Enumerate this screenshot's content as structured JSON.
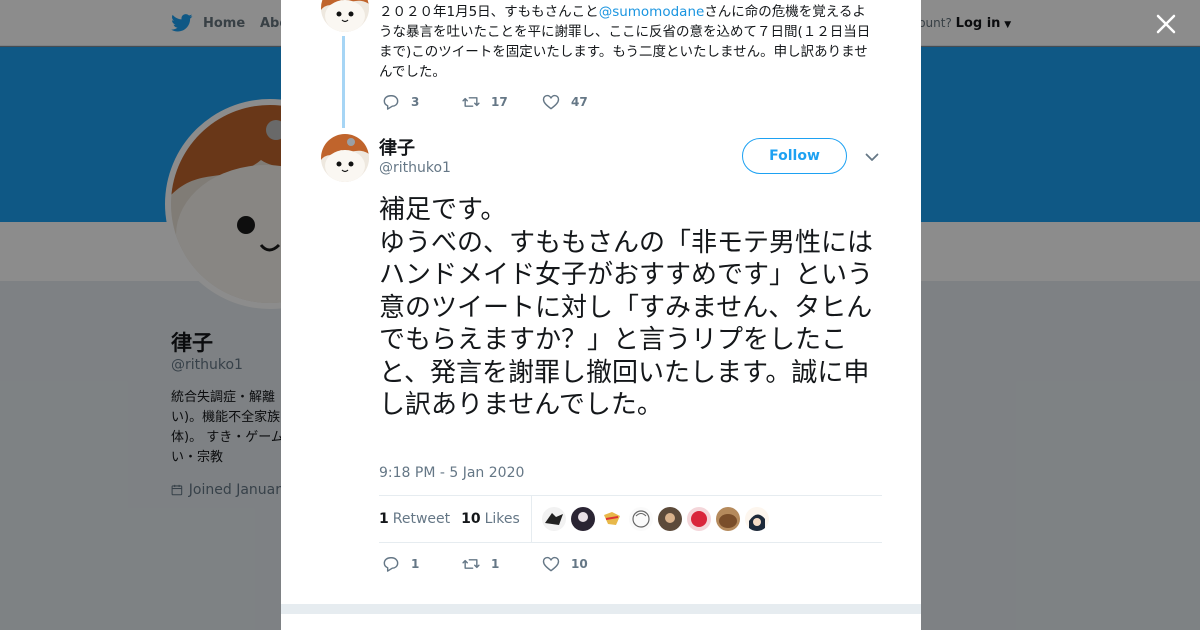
{
  "background": {
    "nav_home": "Home",
    "nav_about": "Abo",
    "account_prompt": "ccount?",
    "login_label": "Log in",
    "profile_name": "律子",
    "profile_handle": "@rithuko1",
    "bio": "統合失調症・解離 い)。機能不全家族 体)。 すき・ゲーム い・宗教",
    "joined": "Joined Januar",
    "banner_color": "#1da1f2"
  },
  "parent_tweet": {
    "text_before": "２０２０年1月5日、すももさんこと",
    "mention": "@sumomodane",
    "text_after": "さんに命の危機を覚えるような暴言を吐いたことを平に謝罪し、ここに反省の意を込めて７日間(１２日当日まで)このツイートを固定いたします。もう二度といたしません。申し訳ありませんでした。",
    "replies": "3",
    "retweets": "17",
    "likes": "47"
  },
  "tweet": {
    "author_name": "律子",
    "author_handle": "@rithuko1",
    "follow_label": "Follow",
    "body": "補足です。\nゆうべの、すももさんの「非モテ男性にはハンドメイド女子がおすすめです」という意のツイートに対し「すみません、タヒんでもらえますか？」と言うリプをしたこと、発言を謝罪し撤回いたします。誠に申し訳ありませんでした。",
    "timestamp": "9:18 PM - 5 Jan 2020",
    "retweet_count": "1",
    "retweet_label": "Retweet",
    "like_count": "10",
    "like_label": "Likes",
    "replies": "1",
    "retweets": "1",
    "likes": "10"
  },
  "colors": {
    "accent": "#1da1f2",
    "mention": "#1b95e0",
    "thread_line": "#a6d5f5"
  }
}
